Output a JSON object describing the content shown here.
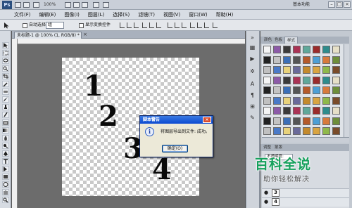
{
  "app": {
    "logo": "Ps",
    "zoom": "100%",
    "workspace": "基本功能",
    "window_controls": [
      "–",
      "□",
      "×"
    ]
  },
  "menu": [
    "文件(F)",
    "编辑(E)",
    "图像(I)",
    "图层(L)",
    "选择(S)",
    "滤镜(T)",
    "视图(V)",
    "窗口(W)",
    "帮助(H)"
  ],
  "options": {
    "auto_select_label": "自动选择:",
    "auto_select_value": "组",
    "show_transform_label": "显示变换控件"
  },
  "document": {
    "tab_title": "未标题-1 @ 100% (1, RGB/8) *",
    "tab_close": "×",
    "digits": [
      "1",
      "2",
      "3",
      "4"
    ]
  },
  "dialog": {
    "title": "脚本警告",
    "close": "×",
    "info_icon": "i",
    "message": "将图层导出到文件: 成功。",
    "ok_label": "确定(O)"
  },
  "panel": {
    "tabs": [
      "颜色",
      "色板",
      "样式"
    ],
    "adjust_tabs": [
      "调整",
      "蒙版"
    ],
    "blend_value": "不透明度:"
  },
  "layers": [
    {
      "eye": "●",
      "thumb": "3"
    },
    {
      "eye": "●",
      "thumb": "4"
    }
  ],
  "watermark": {
    "main": "百科全说",
    "sub": "助你轻松解决",
    "logo": "b"
  },
  "colors": {
    "dialog_title": "#0b4ad1",
    "watermark_green": "#15a05c",
    "canvas_check": "#c9c9c9"
  }
}
